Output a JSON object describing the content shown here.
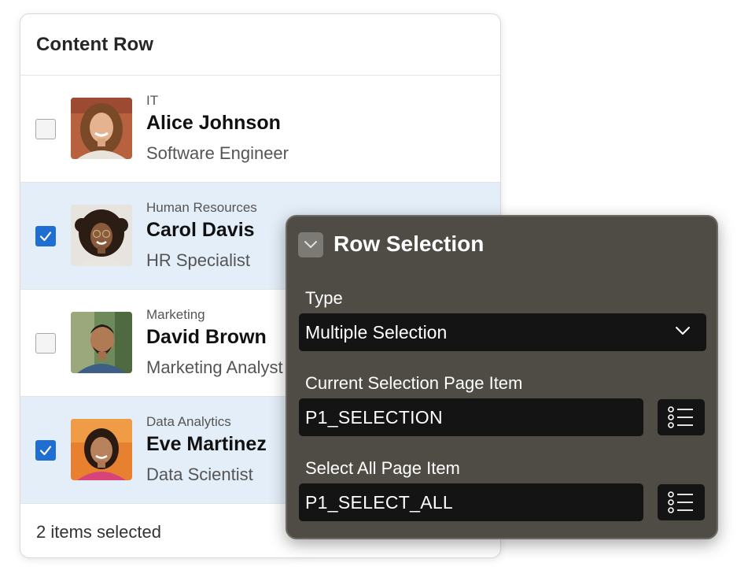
{
  "content_row": {
    "title": "Content Row",
    "rows": [
      {
        "overline": "IT",
        "title": "Alice Johnson",
        "subtitle": "Software Engineer",
        "selected": false,
        "avatar_icon": "person-photo-icon"
      },
      {
        "overline": "Human Resources",
        "title": "Carol Davis",
        "subtitle": "HR Specialist",
        "selected": true,
        "avatar_icon": "person-photo-icon"
      },
      {
        "overline": "Marketing",
        "title": "David Brown",
        "subtitle": "Marketing Analyst",
        "selected": false,
        "avatar_icon": "person-photo-icon"
      },
      {
        "overline": "Data Analytics",
        "title": "Eve Martinez",
        "subtitle": "Data Scientist",
        "selected": true,
        "avatar_icon": "person-photo-icon"
      }
    ],
    "footer": "2 items selected"
  },
  "row_selection": {
    "title": "Row Selection",
    "toggle_icon": "chevron-down-icon",
    "type_label": "Type",
    "type_value": "Multiple Selection",
    "current_selection_label": "Current Selection Page Item",
    "current_selection_value": "P1_SELECTION",
    "select_all_label": "Select All Page Item",
    "select_all_value": "P1_SELECT_ALL",
    "list_icon": "list-icon"
  },
  "colors": {
    "selected_row_bg": "#e4eef9",
    "checkbox_checked": "#1f6fd2",
    "panel_bg": "#4f4c45",
    "input_bg": "#141414"
  }
}
